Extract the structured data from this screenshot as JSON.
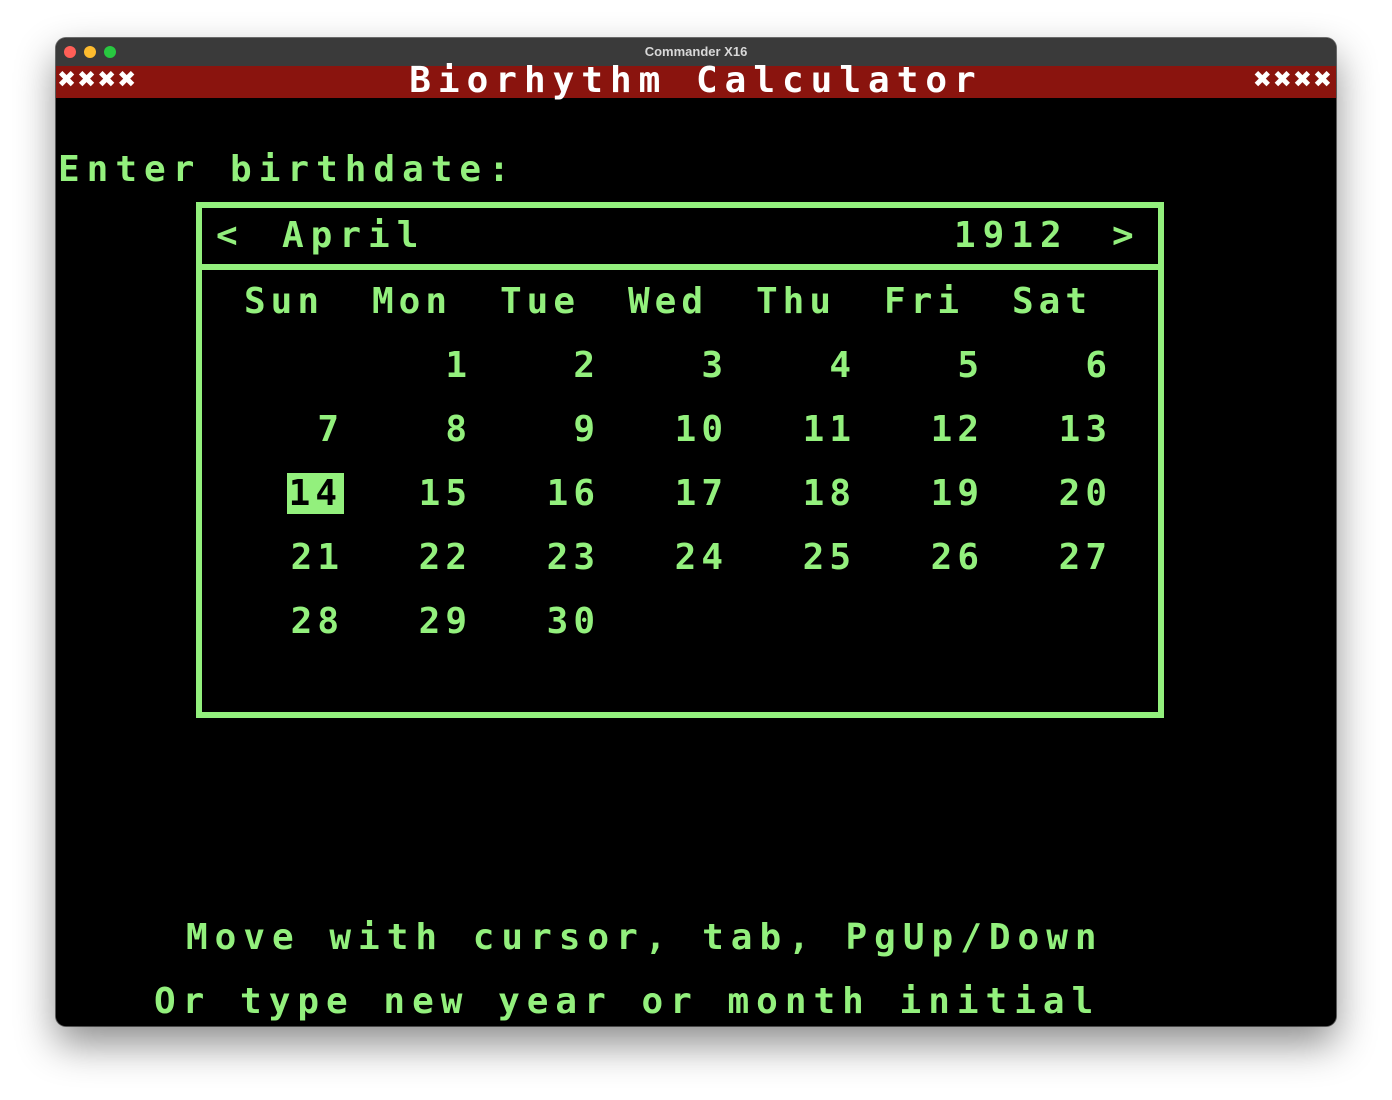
{
  "window": {
    "title": "Commander X16"
  },
  "banner": {
    "deco_left": "✖✖✖✖",
    "title": "Biorhythm Calculator",
    "deco_right": "✖✖✖✖"
  },
  "prompt": "Enter birthdate:",
  "calendar": {
    "prev": "<",
    "month": "April",
    "year": "1912",
    "next": ">",
    "weekdays": [
      "Sun",
      "Mon",
      "Tue",
      "Wed",
      "Thu",
      "Fri",
      "Sat"
    ],
    "weeks": [
      [
        "",
        "1",
        "2",
        "3",
        "4",
        "5",
        "6"
      ],
      [
        "7",
        "8",
        "9",
        "10",
        "11",
        "12",
        "13"
      ],
      [
        "14",
        "15",
        "16",
        "17",
        "18",
        "19",
        "20"
      ],
      [
        "21",
        "22",
        "23",
        "24",
        "25",
        "26",
        "27"
      ],
      [
        "28",
        "29",
        "30",
        "",
        "",
        "",
        ""
      ]
    ],
    "selected_day": "14"
  },
  "help": {
    "line1": "Move with cursor, tab, PgUp/Down",
    "line2": "Or type new year or month initial"
  },
  "colors": {
    "text": "#93f07d",
    "banner_bg": "#8a140e",
    "screen_bg": "#000000"
  }
}
